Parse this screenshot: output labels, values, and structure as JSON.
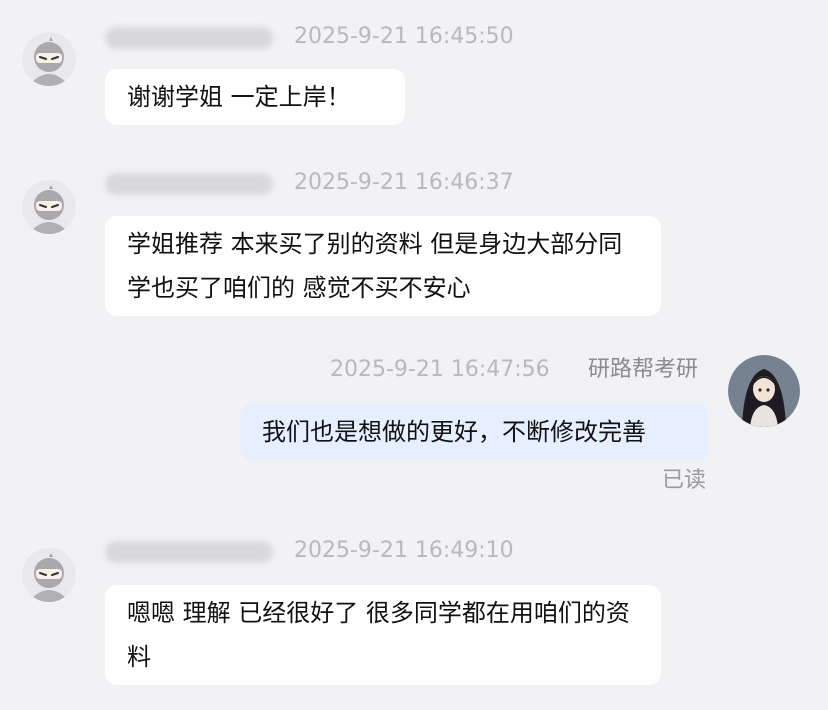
{
  "messages": [
    {
      "sender_blurred": true,
      "time": "2025-9-21 16:45:50",
      "text": "谢谢学姐 一定上岸！"
    },
    {
      "sender_blurred": true,
      "time": "2025-9-21 16:46:37",
      "text": "学姐推荐 本来买了别的资料 但是身边大部分同学也买了咱们的 感觉不买不安心"
    },
    {
      "sender": "研路帮考研",
      "time": "2025-9-21 16:47:56",
      "text": "我们也是想做的更好，不断修改完善",
      "status": "已读"
    },
    {
      "sender_blurred": true,
      "time": "2025-9-21 16:49:10",
      "text": "嗯嗯 理解 已经很好了 很多同学都在用咱们的资料"
    }
  ],
  "colors": {
    "background": "#f2f2f4",
    "bubble_incoming": "#ffffff",
    "bubble_outgoing": "#e6efff",
    "timestamp": "#b8b8be"
  },
  "icons": {
    "incoming_avatar": "ninja-avatar-icon",
    "outgoing_avatar": "user-avatar-photo"
  }
}
